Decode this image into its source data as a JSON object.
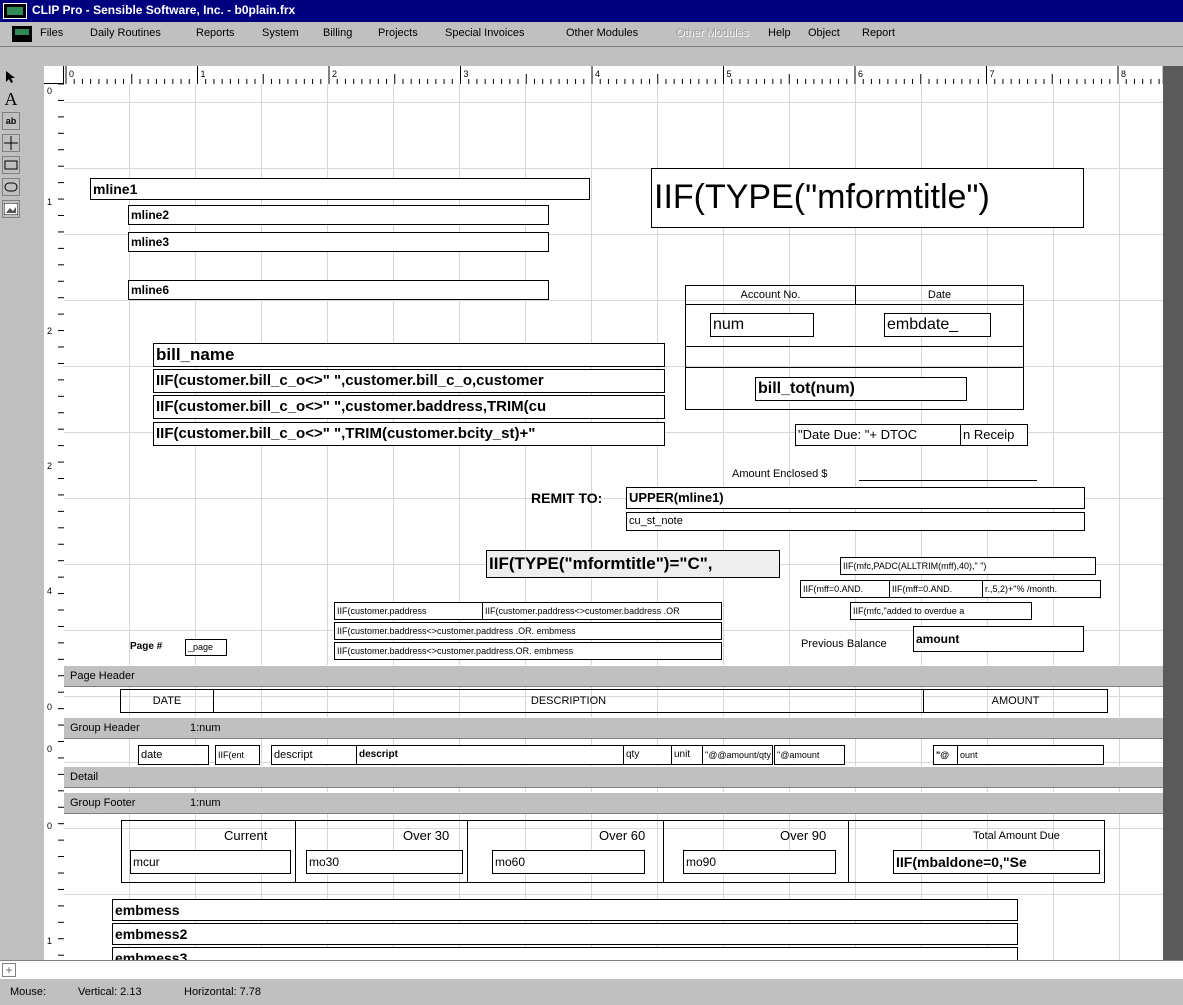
{
  "window": {
    "title": "CLIP Pro - Sensible Software, Inc. - b0plain.frx"
  },
  "menu": [
    "Files",
    "Daily Routines",
    "Reports",
    "System",
    "Billing",
    "Projects",
    "Special Invoices",
    "Other Modules",
    "Other Modules",
    "Help",
    "Object",
    "Report"
  ],
  "menu_disabled_index": 8,
  "tools": [
    "pointer-icon",
    "text-icon",
    "field-icon",
    "line-icon",
    "rectangle-icon",
    "rounded-rectangle-icon",
    "picture-icon"
  ],
  "ruler": {
    "top": [
      "0",
      "1",
      "2",
      "3",
      "4",
      "5",
      "6",
      "7",
      "8"
    ],
    "left": [
      "0",
      "1",
      "2",
      "2",
      "4",
      "0",
      "0",
      "0",
      "1"
    ]
  },
  "fields": {
    "mline1": "mline1",
    "mline2": "mline2",
    "mline3": "mline3",
    "mline6": "mline6",
    "formtitle": "IIF(TYPE(\"mformtitle\")",
    "bill_name": "bill_name",
    "addr1": "IIF(customer.bill_c_o<>\" \",customer.bill_c_o,customer",
    "addr2": "IIF(customer.bill_c_o<>\" \",customer.baddress,TRIM(cu",
    "addr3": "IIF(customer.bill_c_o<>\" \",TRIM(customer.bcity_st)+\"",
    "acct_label": "Account No.",
    "date_label": "Date",
    "num": "num",
    "embdate": "embdate_",
    "bill_tot": "bill_tot(num)",
    "date_due": "\"Date Due: \"+ DTOC",
    "receipt": "n Receip",
    "amount_enclosed": "Amount Enclosed $",
    "remit_label": "REMIT TO:",
    "remit_field": "UPPER(mline1)",
    "cu_st_note": "cu_st_note",
    "formtitle2": "IIF(TYPE(\"mformtitle\")=\"C\",",
    "mfc": "IIF(mfc,PADC(ALLTRIM(mff),40),\" \")",
    "mff1": "IIF(mff=0.AND.",
    "mff2": "IIF(mff=0.AND.",
    "mff3": "r.,5,2)+\"% /month.",
    "mfc2": "IIF(mfc,\"added to overdue a",
    "cp1": "IIF(customer.paddress",
    "cp2": "IIF(customer.paddress<>customer.baddress .OR",
    "cp3": "IIF(customer.baddress<>customer.paddress .OR. embmess",
    "cp4": "IIF(customer.baddress<>customer.paddress.OR. embmess",
    "page_label": "Page #",
    "page_field": "_page",
    "prev_bal": "Previous Balance",
    "amount": "amount"
  },
  "bands": {
    "page_header": "Page Header",
    "group_header": "Group Header",
    "group_header_expr": "1:num",
    "detail": "Detail",
    "group_footer": "Group Footer",
    "group_footer_expr": "1:num"
  },
  "columns": {
    "date": "DATE",
    "description": "DESCRIPTION",
    "amount": "AMOUNT"
  },
  "detail_fields": {
    "date": "date",
    "iif": "IIF(ent",
    "descript": "descript",
    "descript_bold": "descript",
    "qty": "qty",
    "unit": "unit",
    "amountqty": "\"@@amount/qty",
    "amount2": "\"@amount",
    "amount_bold": "\"@",
    "amount3": "ount"
  },
  "aging": {
    "labels": [
      "Current",
      "Over 30",
      "Over 60",
      "Over 90",
      "Total Amount Due"
    ],
    "fields": [
      "mcur",
      "mo30",
      "mo60",
      "mo90",
      "IIF(mbaldone=0,\"Se"
    ]
  },
  "footer": {
    "embmess": "embmess",
    "embmess2": "embmess2",
    "embmess3": "embmess3"
  },
  "status": {
    "mouse": "Mouse:",
    "vertical": "Vertical: 2.13",
    "horizontal": "Horizontal: 7.78"
  }
}
